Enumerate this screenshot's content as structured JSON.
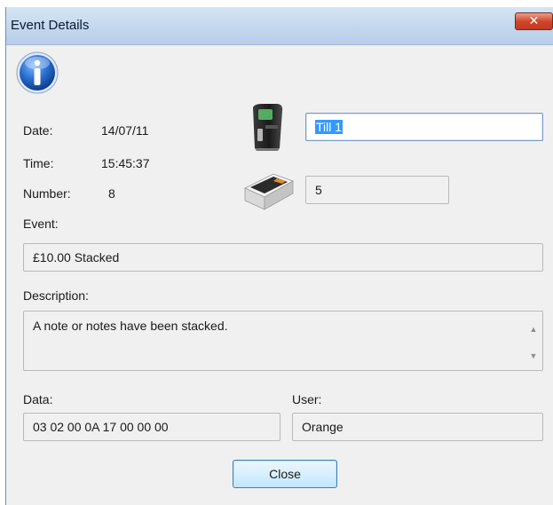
{
  "window": {
    "title": "Event Details",
    "close_glyph": "✕"
  },
  "info": {
    "date_label": "Date:",
    "date_value": "14/07/11",
    "time_label": "Time:",
    "time_value": "15:45:37",
    "number_label": "Number:",
    "number_value": "8"
  },
  "device": {
    "till_value": "Till 1",
    "cassette_value": "5"
  },
  "event": {
    "label": "Event:",
    "value": "£10.00 Stacked"
  },
  "description": {
    "label": "Description:",
    "value": "A note or notes have been stacked."
  },
  "data": {
    "label": "Data:",
    "value": "03 02 00 0A 17 00 00 00"
  },
  "user": {
    "label": "User:",
    "value": "Orange"
  },
  "buttons": {
    "close_label": "Close"
  },
  "icons": {
    "info": "info-icon",
    "till": "till-terminal-icon",
    "cassette": "note-cassette-icon"
  },
  "colors": {
    "titlebar": "#c3d7ee",
    "close_button": "#d0472c",
    "selection": "#3399ff",
    "info_blue": "#1d5fbf"
  }
}
